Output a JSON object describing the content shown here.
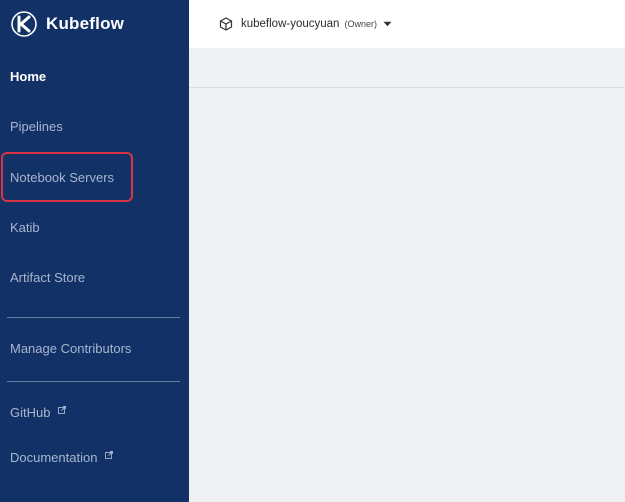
{
  "brand": {
    "name": "Kubeflow",
    "logo_icon": "kubeflow-logo-icon"
  },
  "sidebar": {
    "items": [
      {
        "label": "Home",
        "active": true
      },
      {
        "label": "Pipelines"
      },
      {
        "label": "Notebook Servers",
        "highlighted": true
      },
      {
        "label": "Katib"
      },
      {
        "label": "Artifact Store"
      },
      {
        "label": "Manage Contributors"
      },
      {
        "label": "GitHub",
        "external": true
      },
      {
        "label": "Documentation",
        "external": true
      }
    ],
    "colors": {
      "background": "#123166",
      "active_text": "#ffffff",
      "text": "#a7b6cf",
      "highlight": "#d73445"
    }
  },
  "topbar": {
    "namespace": "kubeflow-youcyuan",
    "role": "(Owner)",
    "namespace_icon": "cube-icon",
    "dropdown_icon": "caret-down-icon"
  }
}
